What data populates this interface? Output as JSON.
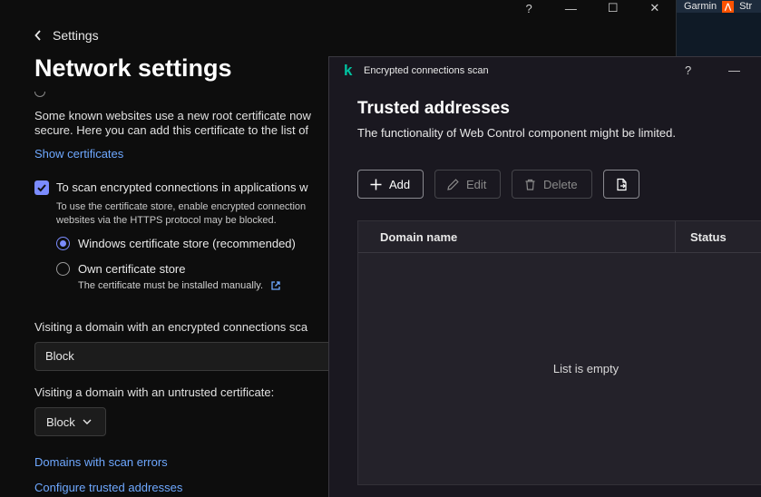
{
  "window": {
    "controls": [
      "?",
      "—",
      "☐",
      "✕"
    ]
  },
  "taskbar": {
    "items": [
      "Garmin",
      "Str"
    ]
  },
  "nav": {
    "back_label": "Settings"
  },
  "page": {
    "title": "Network settings",
    "description_line1": "Some known websites use a new root certificate now",
    "description_line2": "secure. Here you can add this certificate to the list of",
    "show_certificates": "Show certificates",
    "scan_checkbox_label": "To scan encrypted connections in applications w",
    "scan_note_line1": "To use the certificate store, enable encrypted connection",
    "scan_note_line2": "websites via the HTTPS protocol may be blocked.",
    "radio_windows": "Windows certificate store (recommended)",
    "radio_own": "Own certificate store",
    "radio_own_note": "The certificate must be installed manually.",
    "visit_encrypted_label": "Visiting a domain with an encrypted connections sca",
    "visit_encrypted_value": "Block",
    "visit_untrusted_label": "Visiting a domain with an untrusted certificate:",
    "visit_untrusted_value": "Block",
    "domains_with_errors": "Domains with scan errors",
    "configure_trusted": "Configure trusted addresses"
  },
  "dialog": {
    "title": "Encrypted connections scan",
    "help": "?",
    "minimize": "—",
    "heading": "Trusted addresses",
    "subtitle": "The functionality of Web Control component might be limited.",
    "buttons": {
      "add": "Add",
      "edit": "Edit",
      "delete": "Delete"
    },
    "columns": {
      "domain": "Domain name",
      "status": "Status"
    },
    "empty_text": "List is empty"
  },
  "colors": {
    "accent": "#7b8cff",
    "link": "#6ea8ff",
    "logo": "#00c2a0"
  }
}
